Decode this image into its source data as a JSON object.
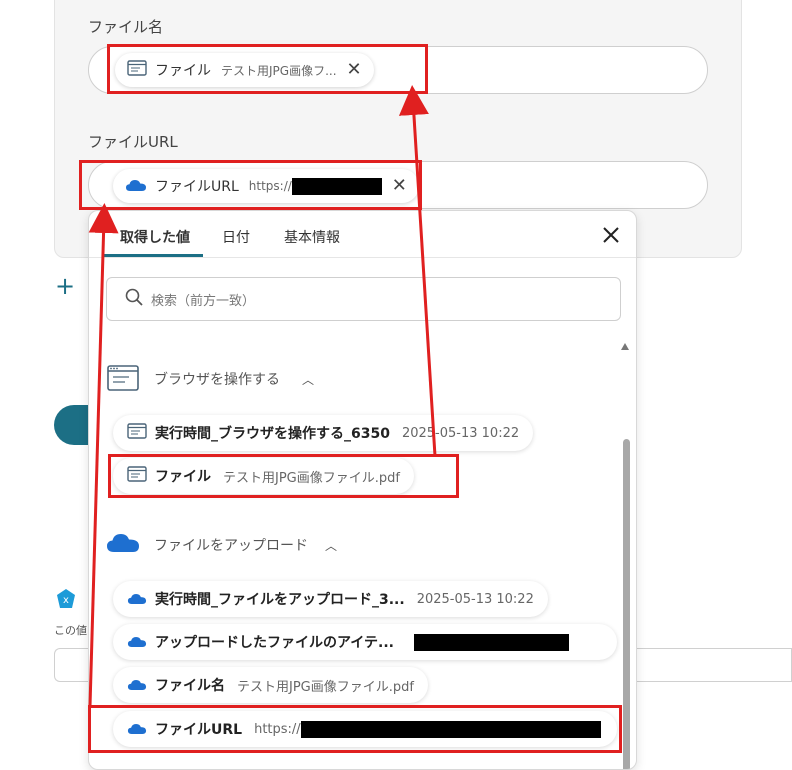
{
  "form": {
    "file_name_label": "ファイル名",
    "file_url_label": "ファイルURL",
    "file_chip": {
      "label": "ファイル",
      "value": "テスト用JPG画像フ..."
    },
    "url_chip": {
      "label": "ファイルURL",
      "value": "https://"
    }
  },
  "background": {
    "add_icon": "+",
    "note_text": "この値"
  },
  "popup": {
    "tabs": [
      "取得した値",
      "日付",
      "基本情報"
    ],
    "search_placeholder": "検索（前方一致）",
    "sections": [
      {
        "title": "ブラウザを操作する",
        "icon": "browser-icon",
        "items": [
          {
            "label": "実行時間_ブラウザを操作する_6350",
            "value": "2025-05-13 10:22"
          },
          {
            "label": "ファイル",
            "value": "テスト用JPG画像ファイル.pdf"
          }
        ]
      },
      {
        "title": "ファイルをアップロード",
        "icon": "onedrive-cloud-icon",
        "items": [
          {
            "label": "実行時間_ファイルをアップロード_3...",
            "value": "2025-05-13 10:22"
          },
          {
            "label": "アップロードしたファイルのアイテ...",
            "value": ""
          },
          {
            "label": "ファイル名",
            "value": "テスト用JPG画像ファイル.pdf"
          },
          {
            "label": "ファイルURL",
            "value": "https://"
          }
        ]
      }
    ]
  },
  "colors": {
    "accent": "#1c6f85",
    "annotation_red": "#e02020",
    "cloud_blue": "#1e6fd0"
  }
}
